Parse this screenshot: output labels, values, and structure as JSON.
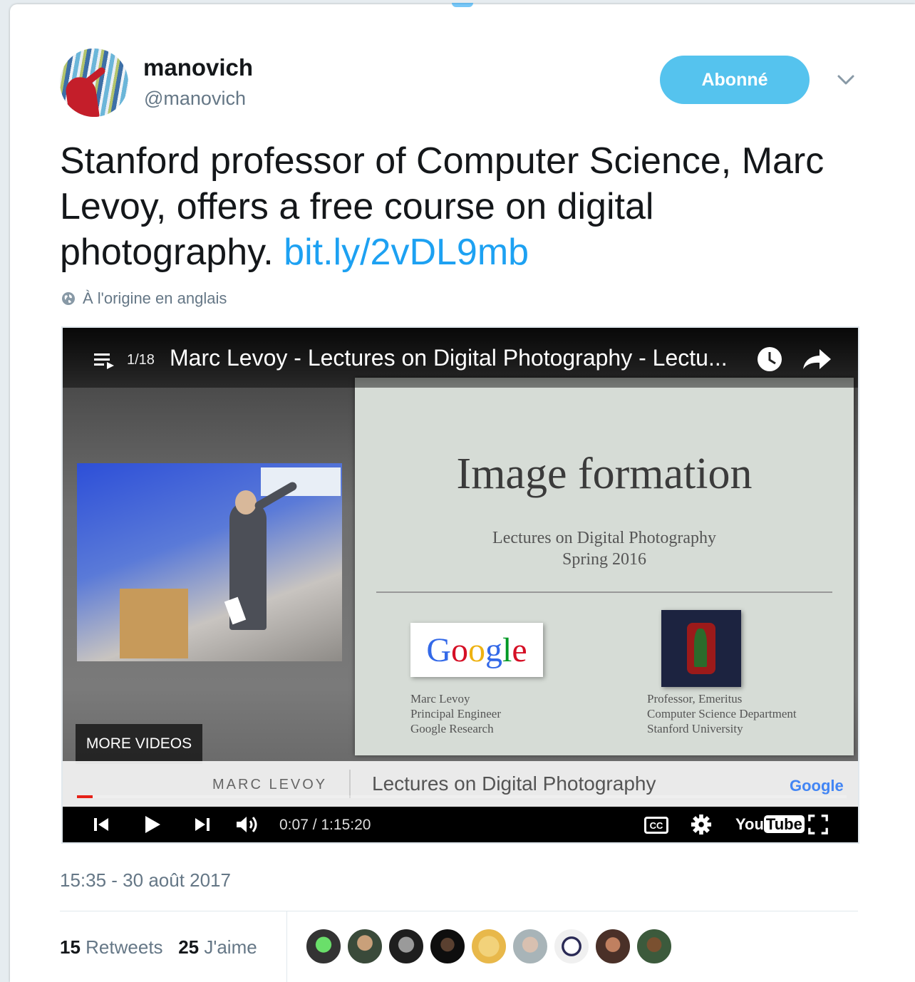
{
  "tweet": {
    "display_name": "manovich",
    "handle": "@manovich",
    "follow_label": "Abonné",
    "text": "Stanford professor of Computer Science, Marc Levoy, offers a free course on digital photography. ",
    "link": "bit.ly/2vDL9mb",
    "translation_note": "À l'origine en anglais",
    "timestamp": "15:35 - 30 août 2017",
    "retweets_count": "15",
    "retweets_label": "Retweets",
    "likes_count": "25",
    "likes_label": "J'aime"
  },
  "video": {
    "playlist_count": "1/18",
    "title": "Marc Levoy - Lectures on Digital Photography - Lectu...",
    "slide_title": "Image formation",
    "slide_subtitle_1": "Lectures on Digital Photography",
    "slide_subtitle_2": "Spring 2016",
    "google_logo_text": "Google",
    "credit_left": [
      "Marc Levoy",
      "Principal Engineer",
      "Google Research"
    ],
    "credit_right": [
      "Professor, Emeritus",
      "Computer Science Department",
      "Stanford University"
    ],
    "more_videos_label": "MORE VIDEOS",
    "lower_third_name": "MARC LEVOY",
    "lower_third_series": "Lectures on Digital Photography",
    "lower_third_brand": "Google",
    "time_display": "0:07 / 1:15:20",
    "cc_label": "CC",
    "youtube_label_you": "You",
    "youtube_label_tube": "Tube",
    "progress_fraction": 0.0016
  },
  "colors": {
    "accent": "#1da1f2",
    "follow_button": "#55c3ee",
    "muted_text": "#657786",
    "progress_red": "#e62117"
  },
  "icons": [
    "chevron-down-icon",
    "globe-icon",
    "playlist-icon",
    "clock-icon",
    "share-icon",
    "previous-icon",
    "play-icon",
    "next-icon",
    "volume-icon",
    "settings-icon",
    "fullscreen-icon"
  ]
}
